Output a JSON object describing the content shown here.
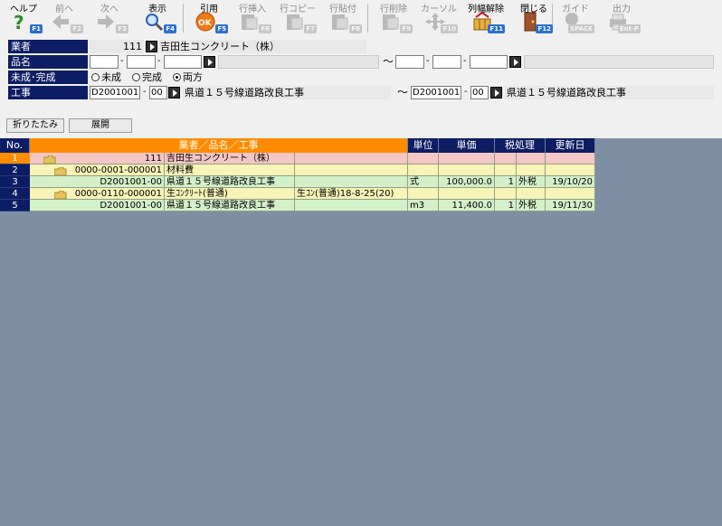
{
  "toolbar": [
    {
      "id": "help",
      "label": "ヘルプ",
      "fkey": "F1",
      "enabled": true,
      "icon": "help-icon"
    },
    {
      "id": "prev",
      "label": "前へ",
      "fkey": "F2",
      "enabled": false,
      "icon": "arrow-left-icon"
    },
    {
      "id": "next",
      "label": "次へ",
      "fkey": "F3",
      "enabled": false,
      "icon": "arrow-right-icon"
    },
    {
      "id": "display",
      "label": "表示",
      "fkey": "F4",
      "enabled": true,
      "icon": "magnifier-icon"
    },
    {
      "id": "cite",
      "label": "引用",
      "fkey": "F5",
      "enabled": true,
      "icon": "ok-icon"
    },
    {
      "id": "row-insert",
      "label": "行挿入",
      "fkey": "F6",
      "enabled": false,
      "icon": "row-insert-icon"
    },
    {
      "id": "row-copy",
      "label": "行コピー",
      "fkey": "F7",
      "enabled": false,
      "icon": "row-copy-icon"
    },
    {
      "id": "row-paste",
      "label": "行貼付",
      "fkey": "F8",
      "enabled": false,
      "icon": "row-paste-icon"
    },
    {
      "id": "row-delete",
      "label": "行削除",
      "fkey": "F9",
      "enabled": false,
      "icon": "row-delete-icon"
    },
    {
      "id": "cursor",
      "label": "カーソル",
      "fkey": "F10",
      "enabled": false,
      "icon": "cursor-move-icon"
    },
    {
      "id": "col-width",
      "label": "列幅解除",
      "fkey": "F11",
      "enabled": true,
      "icon": "column-width-icon"
    },
    {
      "id": "close",
      "label": "閉じる",
      "fkey": "F12",
      "enabled": true,
      "icon": "door-icon"
    },
    {
      "id": "guide",
      "label": "ガイド",
      "fkey": "SPACE",
      "enabled": false,
      "icon": "bulb-icon"
    },
    {
      "id": "output",
      "label": "出力",
      "fkey": "Ent-P",
      "enabled": false,
      "icon": "printer-icon"
    }
  ],
  "form": {
    "vendor": {
      "label": "業者",
      "code": "111",
      "name": "吉田生コンクリート（株）"
    },
    "item": {
      "label": "品名",
      "tilde": "～"
    },
    "status": {
      "label": "未成･完成",
      "options": [
        "未成",
        "完成",
        "両方"
      ],
      "selected": "両方"
    },
    "work": {
      "label": "工事",
      "from_code": "D2001001",
      "from_sub": "00",
      "from_name": "県道１５号線道路改良工事",
      "tilde": "～",
      "to_code": "D2001001",
      "to_sub": "00",
      "to_name": "県道１５号線道路改良工事"
    }
  },
  "buttons": {
    "collapse": "折りたたみ",
    "expand": "展開"
  },
  "grid": {
    "headers": {
      "no": "No.",
      "main": "業者／品名／工事",
      "unit": "単位",
      "price": "単価",
      "tax": "税処理",
      "updated": "更新日"
    },
    "rows": [
      {
        "no": "1",
        "level": 0,
        "code": "111",
        "name": "吉田生コンクリート（株）",
        "spec": "",
        "unit": "",
        "price": "",
        "qty": "",
        "tax": "",
        "date": "",
        "color": "#f5c6c6",
        "selected": true,
        "folder": true
      },
      {
        "no": "2",
        "level": 1,
        "code": "0000-0001-000001",
        "name": "材料費",
        "spec": "",
        "unit": "",
        "price": "",
        "qty": "",
        "tax": "",
        "date": "",
        "color": "#f8f3b7",
        "selected": false,
        "folder": true
      },
      {
        "no": "3",
        "level": 2,
        "code": "D2001001-00",
        "name": "県道１５号線道路改良工事",
        "spec": "",
        "unit": "式",
        "price": "100,000.0",
        "qty": "1",
        "tax": "外税",
        "date": "19/10/20",
        "color": "#d3f0c9",
        "selected": false,
        "folder": false
      },
      {
        "no": "4",
        "level": 1,
        "code": "0000-0110-000001",
        "name": "生ｺﾝｸﾘｰﾄ(普通)",
        "spec": "生ｺﾝ(普通)18-8-25(20)",
        "unit": "",
        "price": "",
        "qty": "",
        "tax": "",
        "date": "",
        "color": "#f8f3b7",
        "selected": false,
        "folder": true
      },
      {
        "no": "5",
        "level": 2,
        "code": "D2001001-00",
        "name": "県道１５号線道路改良工事",
        "spec": "",
        "unit": "m3",
        "price": "11,400.0",
        "qty": "1",
        "tax": "外税",
        "date": "19/11/30",
        "color": "#d3f0c9",
        "selected": false,
        "folder": false
      }
    ]
  }
}
